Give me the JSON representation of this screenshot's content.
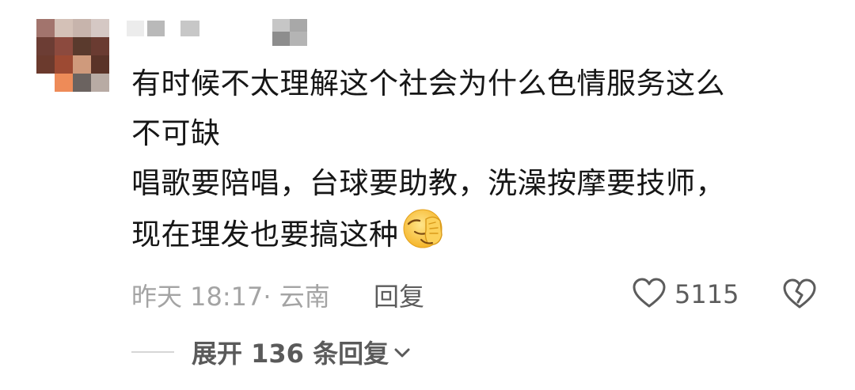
{
  "comment": {
    "lines": [
      "有时候不太理解这个社会为什么色情服务这么",
      "不可缺",
      "唱歌要陪唱，台球要助教，洗澡按摩要技师，",
      "现在理发也要搞这种"
    ],
    "emoji_icon": "facepalm-emoji-icon"
  },
  "meta": {
    "time_location": "昨天 18:17· 云南",
    "reply_label": "回复"
  },
  "actions": {
    "like_icon": "heart-outline-icon",
    "like_count": "5115",
    "dislike_icon": "broken-heart-icon"
  },
  "expand_replies": {
    "label": "展开 136 条回复",
    "icon": "chevron-down-icon"
  },
  "colors": {
    "text": "#161616",
    "meta_text": "#a4a4a4",
    "secondary_text": "#5c5c5c"
  }
}
